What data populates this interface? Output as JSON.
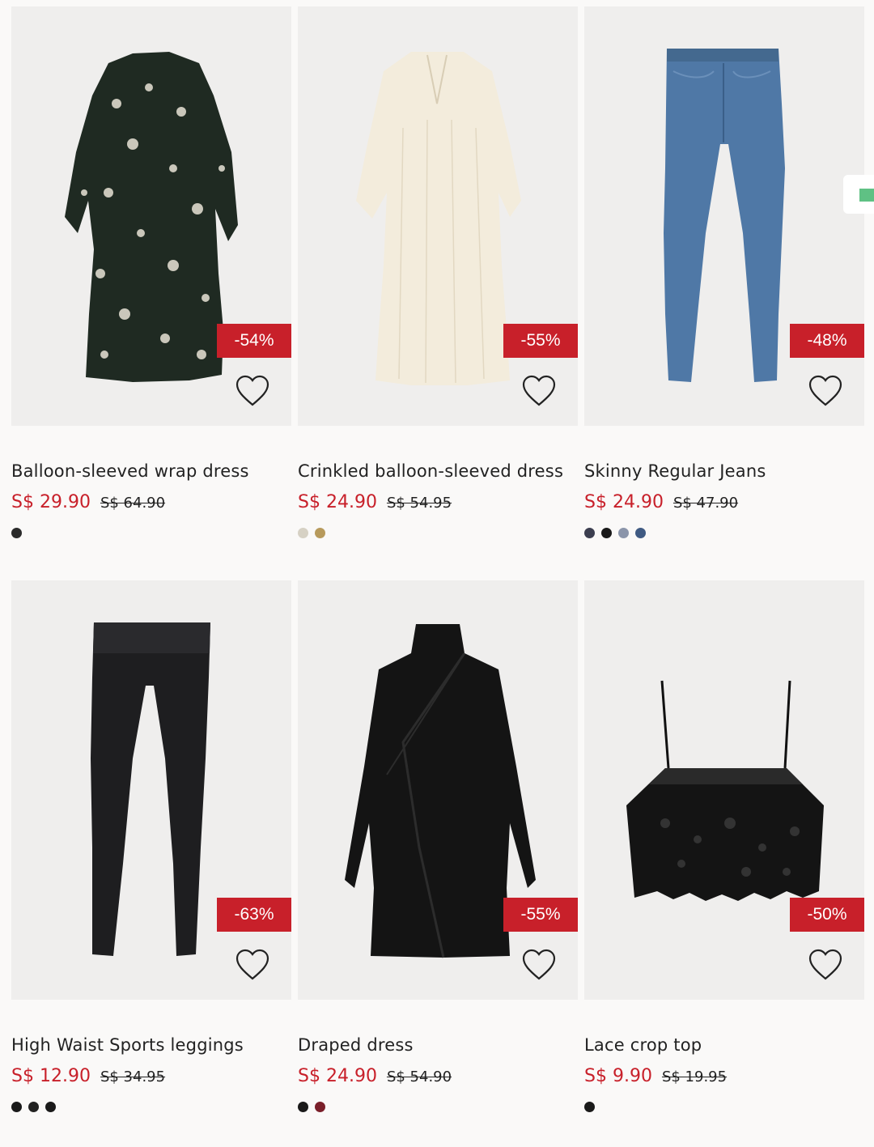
{
  "products": [
    {
      "title": "Balloon-sleeved wrap dress",
      "price": "S$ 29.90",
      "old_price": "S$ 64.90",
      "discount": "-54%",
      "swatches": [
        "#2b2b2b"
      ]
    },
    {
      "title": "Crinkled balloon-sleeved dress",
      "price": "S$ 24.90",
      "old_price": "S$ 54.95",
      "discount": "-55%",
      "swatches": [
        "#d6d1c4",
        "#b79a5c"
      ]
    },
    {
      "title": "Skinny Regular Jeans",
      "price": "S$ 24.90",
      "old_price": "S$ 47.90",
      "discount": "-48%",
      "swatches": [
        "#3b3e4f",
        "#1a1a1a",
        "#8b95aa",
        "#3f5a82"
      ]
    },
    {
      "title": "High Waist Sports leggings",
      "price": "S$ 12.90",
      "old_price": "S$ 34.95",
      "discount": "-63%",
      "swatches": [
        "#1a1a1a",
        "#222222",
        "#1a1a1a"
      ]
    },
    {
      "title": "Draped dress",
      "price": "S$ 24.90",
      "old_price": "S$ 54.90",
      "discount": "-55%",
      "swatches": [
        "#1a1a1a",
        "#7a1f2a"
      ]
    },
    {
      "title": "Lace crop top",
      "price": "S$ 9.90",
      "old_price": "S$ 19.95",
      "discount": "-50%",
      "swatches": [
        "#1a1a1a"
      ]
    }
  ],
  "colors": {
    "accent": "#c8202a",
    "card_bg": "#efeeed",
    "page_bg": "#faf9f8"
  },
  "icons": {
    "favorite": "heart-icon"
  }
}
